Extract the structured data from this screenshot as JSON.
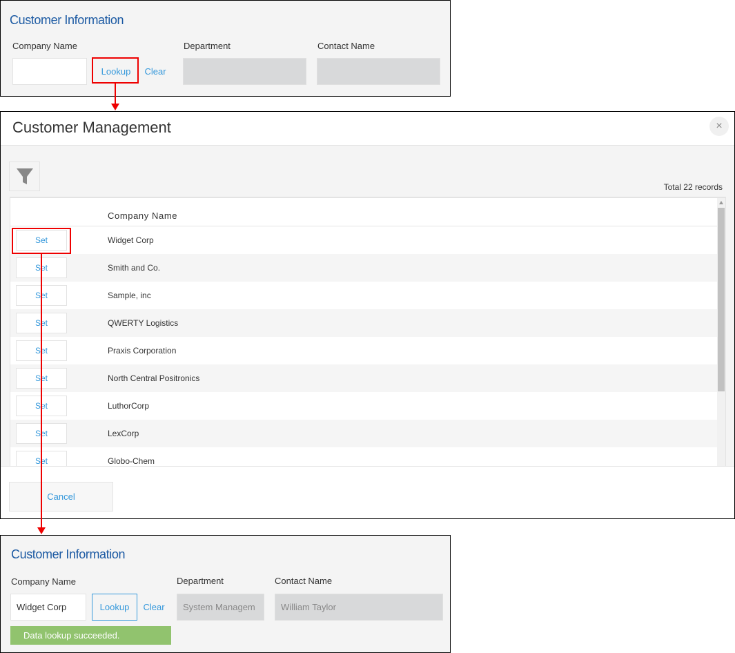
{
  "before": {
    "title": "Customer Information",
    "company_label": "Company Name",
    "company_value": "",
    "lookup_label": "Lookup",
    "clear_label": "Clear",
    "department_label": "Department",
    "department_value": "",
    "contact_label": "Contact Name",
    "contact_value": ""
  },
  "modal": {
    "title": "Customer Management",
    "close_icon": "×",
    "filter_icon": "funnel-icon",
    "total": "Total 22 records",
    "column_header": "Company Name",
    "set_label": "Set",
    "rows": [
      "Widget Corp",
      "Smith and Co.",
      "Sample, inc",
      "QWERTY Logistics",
      "Praxis Corporation",
      "North Central Positronics",
      "LuthorCorp",
      "LexCorp",
      "Globo-Chem"
    ],
    "cancel_label": "Cancel"
  },
  "after": {
    "title": "Customer Information",
    "company_label": "Company Name",
    "company_value": "Widget Corp",
    "lookup_label": "Lookup",
    "clear_label": "Clear",
    "department_label": "Department",
    "department_value": "System Managem",
    "contact_label": "Contact Name",
    "contact_value": "William Taylor",
    "success_message": "Data lookup succeeded."
  },
  "colors": {
    "accent": "#3498db",
    "title": "#1c5aa3",
    "highlight": "#e00000",
    "success": "#91c36e"
  }
}
